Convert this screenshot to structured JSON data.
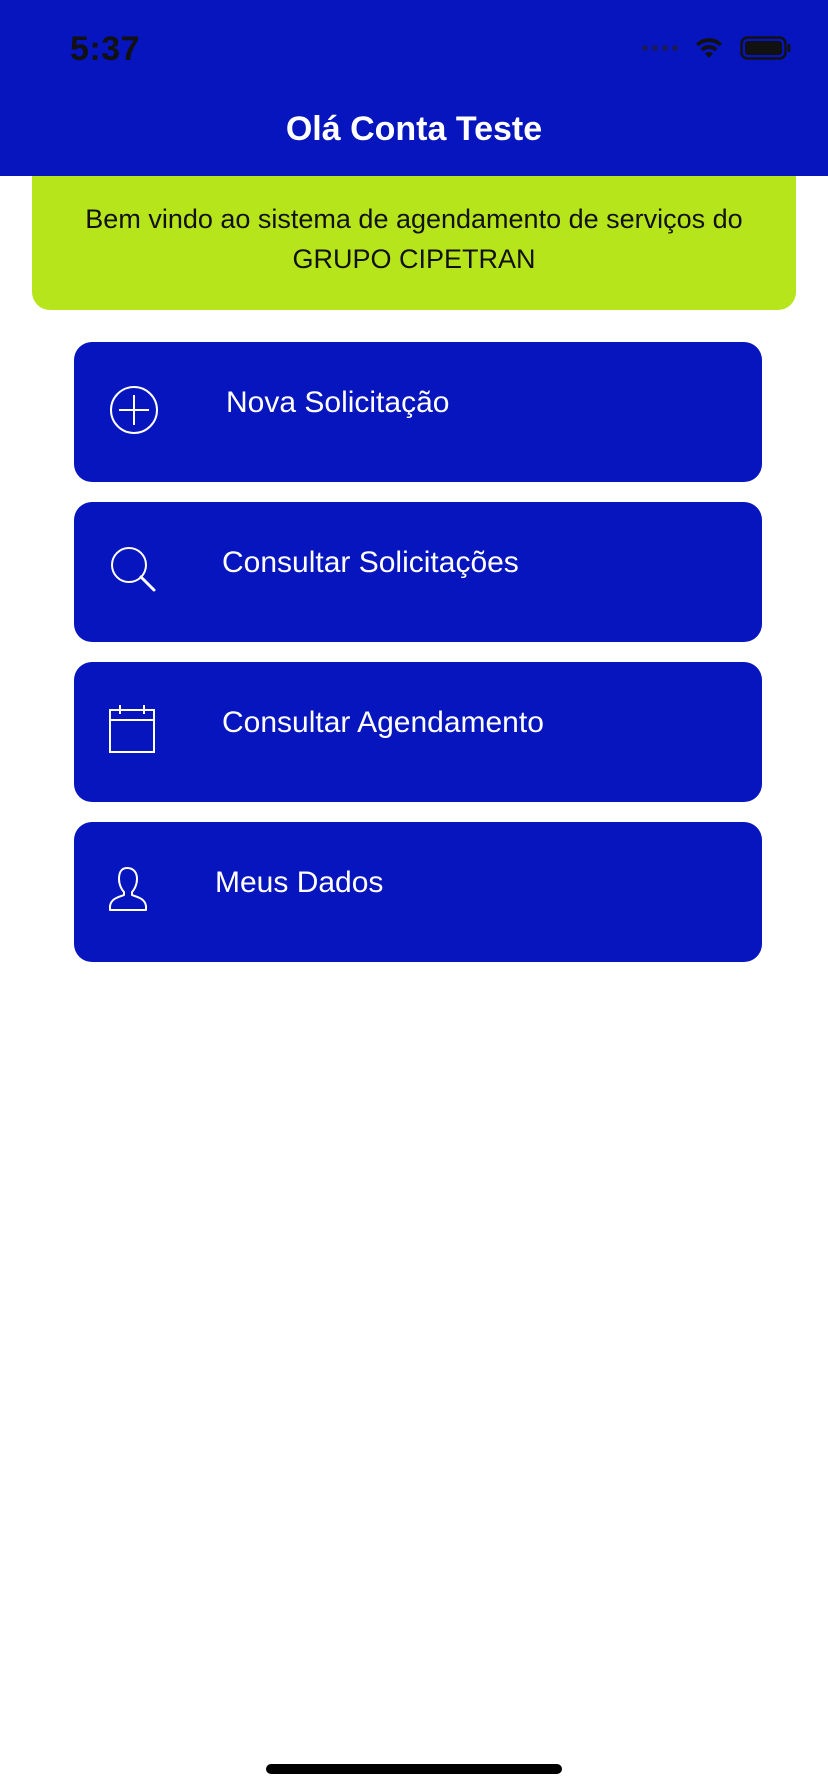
{
  "status_bar": {
    "time": "5:37"
  },
  "header": {
    "title": "Olá Conta Teste"
  },
  "welcome": {
    "line1": "Bem vindo ao sistema de agendamento de serviços do",
    "line2": "GRUPO CIPETRAN"
  },
  "menu": {
    "items": [
      {
        "label": "Nova Solicitação",
        "icon": "plus-circle-icon"
      },
      {
        "label": "Consultar Solicitações",
        "icon": "search-icon"
      },
      {
        "label": "Consultar Agendamento",
        "icon": "calendar-icon"
      },
      {
        "label": "Meus Dados",
        "icon": "user-icon"
      }
    ]
  },
  "colors": {
    "primary": "#0615bd",
    "accent": "#b7e51b",
    "background": "#ffffff"
  }
}
